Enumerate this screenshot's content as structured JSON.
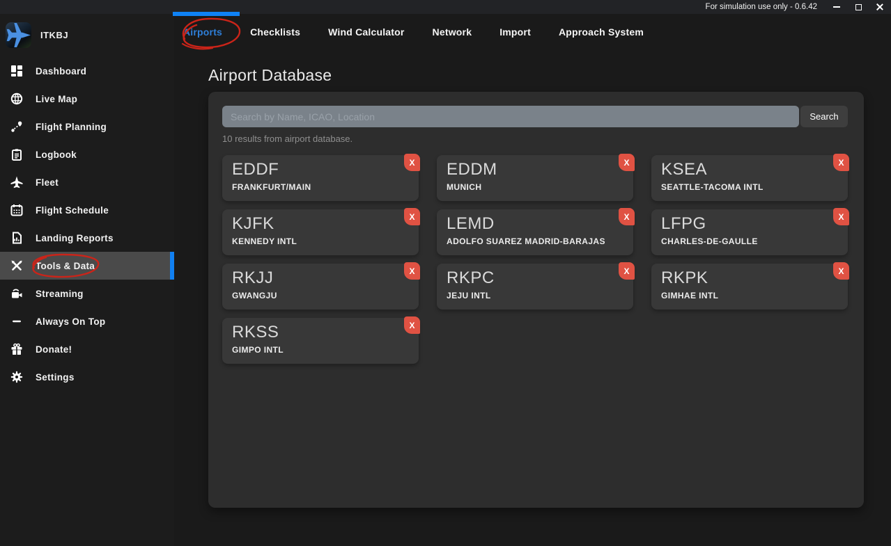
{
  "titlebar": {
    "text": "For simulation use only - 0.6.42"
  },
  "sidebar": {
    "app_name": "ITKBJ",
    "items": [
      {
        "label": "Dashboard",
        "icon": "dashboard-icon",
        "selected": false
      },
      {
        "label": "Live Map",
        "icon": "globe-icon",
        "selected": false
      },
      {
        "label": "Flight Planning",
        "icon": "route-icon",
        "selected": false
      },
      {
        "label": "Logbook",
        "icon": "clipboard-icon",
        "selected": false
      },
      {
        "label": "Fleet",
        "icon": "airplane-icon",
        "selected": false
      },
      {
        "label": "Flight Schedule",
        "icon": "calendar-icon",
        "selected": false
      },
      {
        "label": "Landing Reports",
        "icon": "report-icon",
        "selected": false
      },
      {
        "label": "Tools & Data",
        "icon": "tools-icon",
        "selected": true
      },
      {
        "label": "Streaming",
        "icon": "camera-icon",
        "selected": false
      },
      {
        "label": "Always On Top",
        "icon": "dash-icon",
        "selected": false
      },
      {
        "label": "Donate!",
        "icon": "gift-icon",
        "selected": false
      },
      {
        "label": "Settings",
        "icon": "gear-icon",
        "selected": false
      }
    ]
  },
  "tabs": [
    {
      "label": "Airports",
      "active": true
    },
    {
      "label": "Checklists",
      "active": false
    },
    {
      "label": "Wind Calculator",
      "active": false
    },
    {
      "label": "Network",
      "active": false
    },
    {
      "label": "Import",
      "active": false
    },
    {
      "label": "Approach System",
      "active": false
    }
  ],
  "main": {
    "title": "Airport Database",
    "search": {
      "placeholder": "Search by Name, ICAO, Location",
      "value": "",
      "button_label": "Search"
    },
    "results_text": "10 results from airport database.",
    "delete_label": "X",
    "airports": [
      {
        "icao": "EDDF",
        "name": "FRANKFURT/MAIN"
      },
      {
        "icao": "EDDM",
        "name": "MUNICH"
      },
      {
        "icao": "KSEA",
        "name": "SEATTLE-TACOMA INTL"
      },
      {
        "icao": "KJFK",
        "name": "KENNEDY INTL"
      },
      {
        "icao": "LEMD",
        "name": "ADOLFO SUAREZ MADRID-BARAJAS"
      },
      {
        "icao": "LFPG",
        "name": "CHARLES-DE-GAULLE"
      },
      {
        "icao": "RKJJ",
        "name": "GWANGJU"
      },
      {
        "icao": "RKPC",
        "name": "JEJU INTL"
      },
      {
        "icao": "RKPK",
        "name": "GIMHAE INTL"
      },
      {
        "icao": "RKSS",
        "name": "GIMPO INTL"
      }
    ]
  },
  "colors": {
    "accent_blue": "#0f82f5",
    "active_tab_blue": "#2e7fd9",
    "annotation_red": "#cb2419",
    "delete_red": "#e05243",
    "panel_bg": "#2d2d2d",
    "card_bg": "#383838",
    "search_bg": "#7a828a"
  }
}
